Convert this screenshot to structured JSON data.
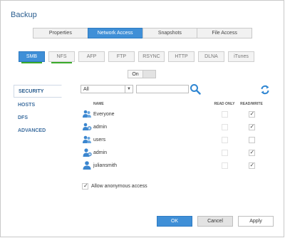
{
  "window": {
    "title": "Backup"
  },
  "main_tabs": [
    {
      "label": "Properties"
    },
    {
      "label": "Network Access"
    },
    {
      "label": "Snapshots"
    },
    {
      "label": "File Access"
    }
  ],
  "protocols": [
    {
      "label": "SMB",
      "enabled": true
    },
    {
      "label": "NFS",
      "enabled": true
    },
    {
      "label": "AFP"
    },
    {
      "label": "FTP"
    },
    {
      "label": "RSYNC"
    },
    {
      "label": "HTTP"
    },
    {
      "label": "DLNA"
    },
    {
      "label": "iTunes"
    }
  ],
  "toggle": {
    "label": "On"
  },
  "sidebar": {
    "items": [
      {
        "label": "SECURITY"
      },
      {
        "label": "HOSTS"
      },
      {
        "label": "DFS"
      },
      {
        "label": "ADVANCED"
      }
    ]
  },
  "filter": {
    "selected": "All",
    "search_value": ""
  },
  "table": {
    "headers": {
      "name": "NAME",
      "read_only": "READ ONLY",
      "read_write": "READ/WRITE"
    },
    "rows": [
      {
        "name": "Everyone",
        "type": "group",
        "read_only": false,
        "read_write": true
      },
      {
        "name": "admin",
        "type": "group",
        "read_only": false,
        "read_write": true
      },
      {
        "name": "users",
        "type": "group",
        "read_only": false,
        "read_write": false
      },
      {
        "name": "admin",
        "type": "user",
        "read_only": false,
        "read_write": true
      },
      {
        "name": "juliansmith",
        "type": "user",
        "read_only": false,
        "read_write": true
      }
    ]
  },
  "anonymous": {
    "label": "Allow anonymous access",
    "checked": true
  },
  "buttons": {
    "ok": "OK",
    "cancel": "Cancel",
    "apply": "Apply"
  },
  "colors": {
    "accent": "#3f8fd7",
    "enabled_bar": "#3aaa2a",
    "title": "#2a5d8f"
  }
}
